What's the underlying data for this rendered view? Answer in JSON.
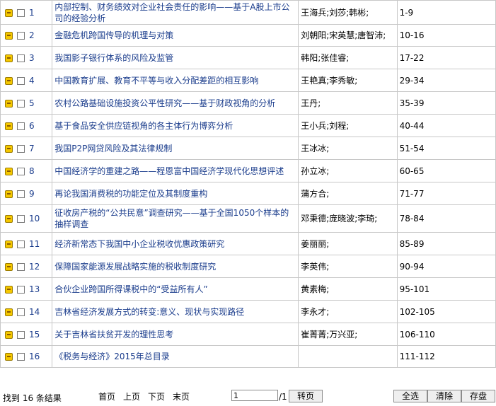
{
  "rows": [
    {
      "num": "1",
      "title": "内部控制、财务绩效对企业社会责任的影响——基于A股上市公司的经验分析",
      "authors": "王海兵;刘莎;韩彬;",
      "pages": "1-9"
    },
    {
      "num": "2",
      "title": "金融危机跨国传导的机理与对策",
      "authors": "刘朝阳;宋英慧;唐智沛;",
      "pages": "10-16"
    },
    {
      "num": "3",
      "title": "我国影子银行体系的风险及监管",
      "authors": "韩阳;张佳睿;",
      "pages": "17-22"
    },
    {
      "num": "4",
      "title": "中国教育扩展、教育不平等与收入分配差距的相互影响",
      "authors": "王艳真;李秀敏;",
      "pages": "29-34"
    },
    {
      "num": "5",
      "title": "农村公路基础设施投资公平性研究——基于财政视角的分析",
      "authors": "王丹;",
      "pages": "35-39"
    },
    {
      "num": "6",
      "title": "基于食品安全供应链视角的各主体行为博弈分析",
      "authors": "王小兵;刘程;",
      "pages": "40-44"
    },
    {
      "num": "7",
      "title": "我国P2P网贷风险及其法律规制",
      "authors": "王冰冰;",
      "pages": "51-54"
    },
    {
      "num": "8",
      "title": "中国经济学的重建之路——程恩富中国经济学现代化思想评述",
      "authors": "孙立冰;",
      "pages": "60-65"
    },
    {
      "num": "9",
      "title": "再论我国消费税的功能定位及其制度重构",
      "authors": "蒲方合;",
      "pages": "71-77"
    },
    {
      "num": "10",
      "title": "征收房产税的“公共民意”调查研究——基于全国1050个样本的抽样调查",
      "authors": "邓秉德;庞晓波;李琦;",
      "pages": "78-84"
    },
    {
      "num": "11",
      "title": "经济新常态下我国中小企业税收优惠政策研究",
      "authors": "姜丽丽;",
      "pages": "85-89"
    },
    {
      "num": "12",
      "title": "保障国家能源发展战略实施的税收制度研究",
      "authors": "李英伟;",
      "pages": "90-94"
    },
    {
      "num": "13",
      "title": "合伙企业跨国所得课税中的“受益所有人”",
      "authors": "黄素梅;",
      "pages": "95-101"
    },
    {
      "num": "14",
      "title": "吉林省经济发展方式的转变:意义、现状与实现路径",
      "authors": "李永才;",
      "pages": "102-105"
    },
    {
      "num": "15",
      "title": "关于吉林省扶贫开发的理性思考",
      "authors": "崔菁菁;万兴亚;",
      "pages": "106-110"
    },
    {
      "num": "16",
      "title": "《税务与经济》2015年总目录",
      "authors": "",
      "pages": "111-112"
    }
  ],
  "row_heights": [],
  "footer": {
    "found_text": "找到 16 条结果",
    "first_page": "首页",
    "prev_page": "上页",
    "next_page": "下页",
    "last_page": "末页",
    "page_value": "1",
    "total_pages": "/1",
    "go_button": "转页",
    "select_all": "全选",
    "clear": "清除",
    "save": "存盘"
  },
  "colors": {
    "link": "#1a3c8c",
    "border": "#c8c8c8",
    "icon": "#f5c800"
  },
  "icons": {
    "row_icon": "book-icon",
    "row_checkbox": "checkbox"
  }
}
